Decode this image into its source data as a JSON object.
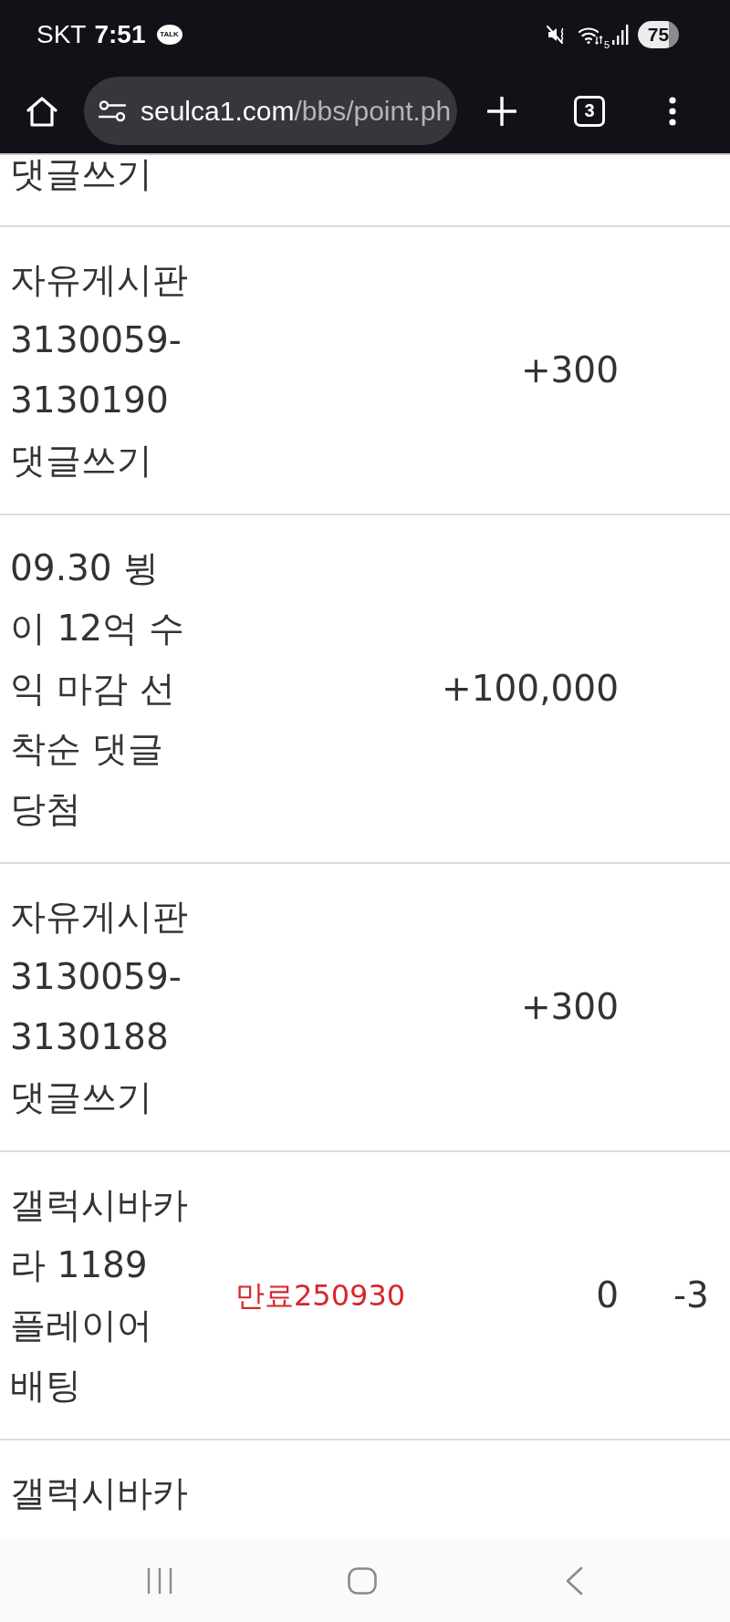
{
  "status_bar": {
    "carrier": "SKT",
    "time": "7:51",
    "notification": "TALK",
    "wifi_label": "5",
    "battery": "75"
  },
  "toolbar": {
    "url_host": "seulca1.com",
    "url_path": "/bbs/point.ph",
    "tab_count": "3"
  },
  "table": {
    "rows": [
      {
        "column_1": "댓글쓰기"
      },
      {
        "column_1": "자유게시판 3130059-3130190 댓글쓰기",
        "column_3": "+300"
      },
      {
        "column_1": "09.30 뷩이 12억 수익 마감 선착순 댓글 당첨",
        "column_3": "+100,000"
      },
      {
        "column_1": "자유게시판 3130059-3130188 댓글쓰기",
        "column_3": "+300"
      },
      {
        "column_1": "갤럭시바카라 1189 플레이어 배팅",
        "column_2": "만료250930",
        "column_3": "0",
        "column_4": "-3"
      },
      {
        "column_1": "갤럭시바카"
      }
    ]
  }
}
